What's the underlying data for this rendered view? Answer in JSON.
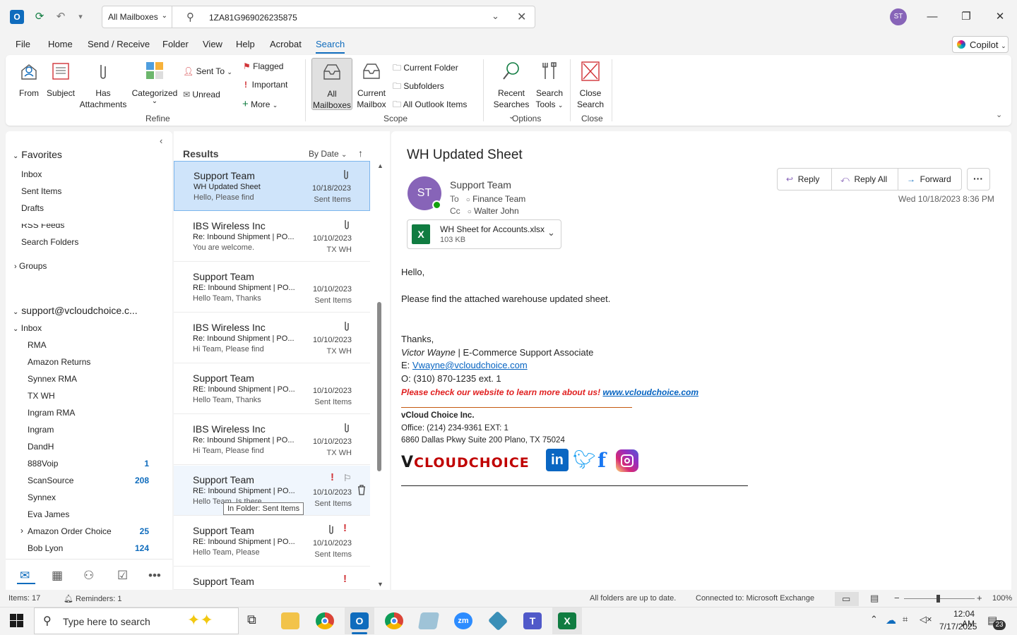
{
  "titlebar": {
    "scope_label": "All Mailboxes",
    "search_query": "1ZA81G969026235875",
    "avatar_initials": "ST"
  },
  "menu": {
    "tabs": [
      "File",
      "Home",
      "Send / Receive",
      "Folder",
      "View",
      "Help",
      "Acrobat",
      "Search"
    ],
    "active": "Search",
    "copilot": "Copilot"
  },
  "ribbon": {
    "refine": {
      "from": "From",
      "subject": "Subject",
      "has_attachments_1": "Has",
      "has_attachments_2": "Attachments",
      "categorized": "Categorized",
      "sent_to": "Sent To",
      "unread": "Unread",
      "flagged": "Flagged",
      "important": "Important",
      "more": "More",
      "group": "Refine"
    },
    "scope": {
      "all_mailboxes_1": "All",
      "all_mailboxes_2": "Mailboxes",
      "current_mailbox_1": "Current",
      "current_mailbox_2": "Mailbox",
      "current_folder": "Current Folder",
      "subfolders": "Subfolders",
      "all_outlook_items": "All Outlook Items",
      "group": "Scope"
    },
    "options": {
      "recent_1": "Recent",
      "recent_2": "Searches",
      "tools_1": "Search",
      "tools_2": "Tools",
      "group": "Options"
    },
    "close": {
      "close_1": "Close",
      "close_2": "Search",
      "group": "Close"
    }
  },
  "nav": {
    "favorites": "Favorites",
    "fav_items": [
      "Inbox",
      "Sent Items",
      "Drafts"
    ],
    "rss": "RSS Feeds",
    "search_folders": "Search Folders",
    "groups": "Groups",
    "account": "support@vcloudchoice.c...",
    "inbox": "Inbox",
    "folders": [
      {
        "name": "RMA",
        "count": ""
      },
      {
        "name": "Amazon Returns",
        "count": ""
      },
      {
        "name": "Synnex RMA",
        "count": ""
      },
      {
        "name": "TX WH",
        "count": ""
      },
      {
        "name": "Ingram RMA",
        "count": ""
      },
      {
        "name": "Ingram",
        "count": ""
      },
      {
        "name": "DandH",
        "count": ""
      },
      {
        "name": "888Voip",
        "count": "1"
      },
      {
        "name": "ScanSource",
        "count": "208"
      },
      {
        "name": "Synnex",
        "count": ""
      },
      {
        "name": "Eva James",
        "count": ""
      },
      {
        "name": "Amazon Order Choice",
        "count": "25"
      },
      {
        "name": "Bob Lyon",
        "count": "124"
      }
    ]
  },
  "list": {
    "title": "Results",
    "sort": "By Date",
    "messages": [
      {
        "sender": "Support Team",
        "subject": "WH Updated Sheet",
        "preview": "Hello,  Please find",
        "date": "10/18/2023",
        "folder": "Sent Items"
      },
      {
        "sender": "IBS Wireless Inc",
        "subject": "Re: Inbound Shipment | PO...",
        "preview": "You are welcome.",
        "date": "10/10/2023",
        "folder": "TX WH"
      },
      {
        "sender": "Support Team",
        "subject": "RE: Inbound Shipment | PO...",
        "preview": "Hello Team,  Thanks",
        "date": "10/10/2023",
        "folder": "Sent Items"
      },
      {
        "sender": "IBS Wireless Inc",
        "subject": "Re: Inbound Shipment | PO...",
        "preview": "Hi Team,  Please find",
        "date": "10/10/2023",
        "folder": "TX WH"
      },
      {
        "sender": "Support Team",
        "subject": "RE: Inbound Shipment | PO...",
        "preview": "Hello Team,  Thanks",
        "date": "10/10/2023",
        "folder": "Sent Items"
      },
      {
        "sender": "IBS Wireless Inc",
        "subject": "Re: Inbound Shipment | PO...",
        "preview": "Hi Team,  Please find",
        "date": "10/10/2023",
        "folder": "TX WH"
      },
      {
        "sender": "Support Team",
        "subject": "RE: Inbound Shipment | PO...",
        "preview": "Hello Team,  Is there",
        "date": "10/10/2023",
        "folder": "Sent Items"
      },
      {
        "sender": "Support Team",
        "subject": "RE: Inbound Shipment | PO...",
        "preview": "Hello Team,  Please",
        "date": "10/10/2023",
        "folder": "Sent Items"
      },
      {
        "sender": "Support Team",
        "subject": "",
        "preview": "",
        "date": "",
        "folder": ""
      }
    ],
    "tooltip": "In Folder: Sent Items"
  },
  "reading": {
    "subject": "WH Updated Sheet",
    "sender": "Support Team",
    "sender_initials": "ST",
    "to_label": "To",
    "to": "Finance Team",
    "cc_label": "Cc",
    "cc": "Walter John",
    "reply": "Reply",
    "reply_all": "Reply All",
    "forward": "Forward",
    "datetime": "Wed 10/18/2023 8:36 PM",
    "attachment_name": "WH Sheet for Accounts.xlsx",
    "attachment_size": "103 KB",
    "greeting": "Hello,",
    "line1": "Please find the attached warehouse updated sheet.",
    "thanks": "Thanks,",
    "sig_name": "Victor Wayne",
    "sig_title": " | E-Commerce Support Associate",
    "email_prefix": "E: ",
    "email": "Vwayne@vcloudchoice.com",
    "phone": "O: (310) 870-1235 ext. 1",
    "website_text": "Please check our website to learn more about us! ",
    "website": "www.vcloudchoice.com",
    "company": "vCloud Choice Inc.",
    "office": "Office: (214) 234-9361 EXT: 1",
    "address": "6860 Dallas Pkwy Suite 200 Plano, TX 75024",
    "logo_text": "VCLOUDCHOICE"
  },
  "status": {
    "items": "Items: 17",
    "reminders": "Reminders: 1",
    "sync": "All folders are up to date.",
    "connection": "Connected to: Microsoft Exchange",
    "zoom": "100%"
  },
  "taskbar": {
    "search_placeholder": "Type here to search",
    "time": "12:04 AM",
    "date": "7/17/2025",
    "notif": "23"
  }
}
